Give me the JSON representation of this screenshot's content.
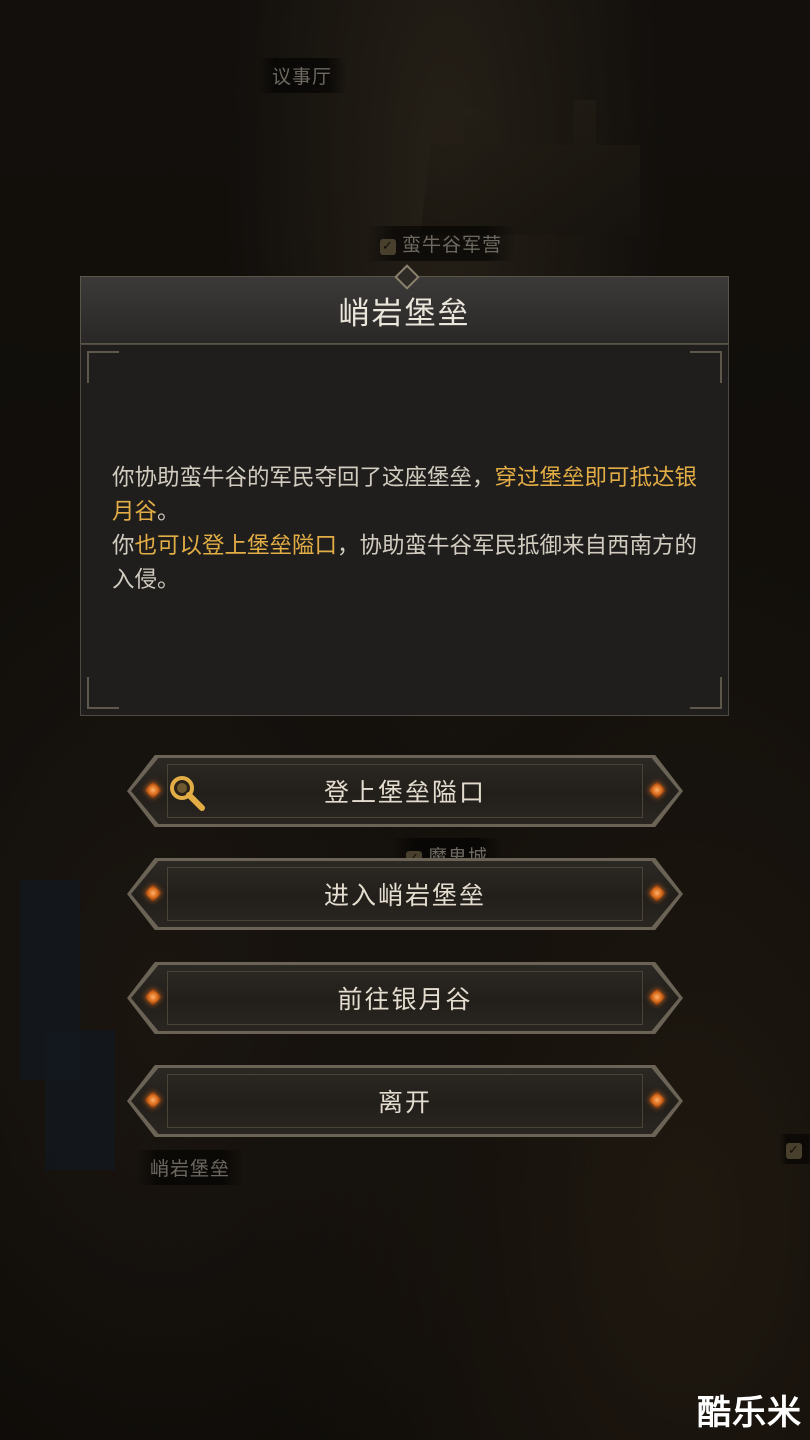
{
  "map": {
    "labels": {
      "council_hall": "议事厅",
      "barbull_camp": "蛮牛谷军营",
      "demon_city": "魔鬼城",
      "fort_label": "峭岩堡垒"
    }
  },
  "dialog": {
    "title": "峭岩堡垒",
    "desc": {
      "p1_text": "你协助蛮牛谷的军民夺回了这座堡垒，",
      "p1_highlight": "穿过堡垒即可抵达银月谷",
      "p1_end": "。",
      "p2_start": "你",
      "p2_highlight": "也可以登上堡垒隘口",
      "p2_text": "，协助蛮牛谷军民抵御来自西南方的入侵。"
    }
  },
  "actions": {
    "climb": "登上堡垒隘口",
    "enter": "进入峭岩堡垒",
    "goto_silvermoon": "前往银月谷",
    "leave": "离开"
  },
  "watermark": "酷乐米",
  "colors": {
    "highlight": "#e3ad45",
    "gem": "#d86a1c"
  },
  "icons": {
    "climb_button": "magnifier-icon",
    "map_check": "check-icon"
  }
}
